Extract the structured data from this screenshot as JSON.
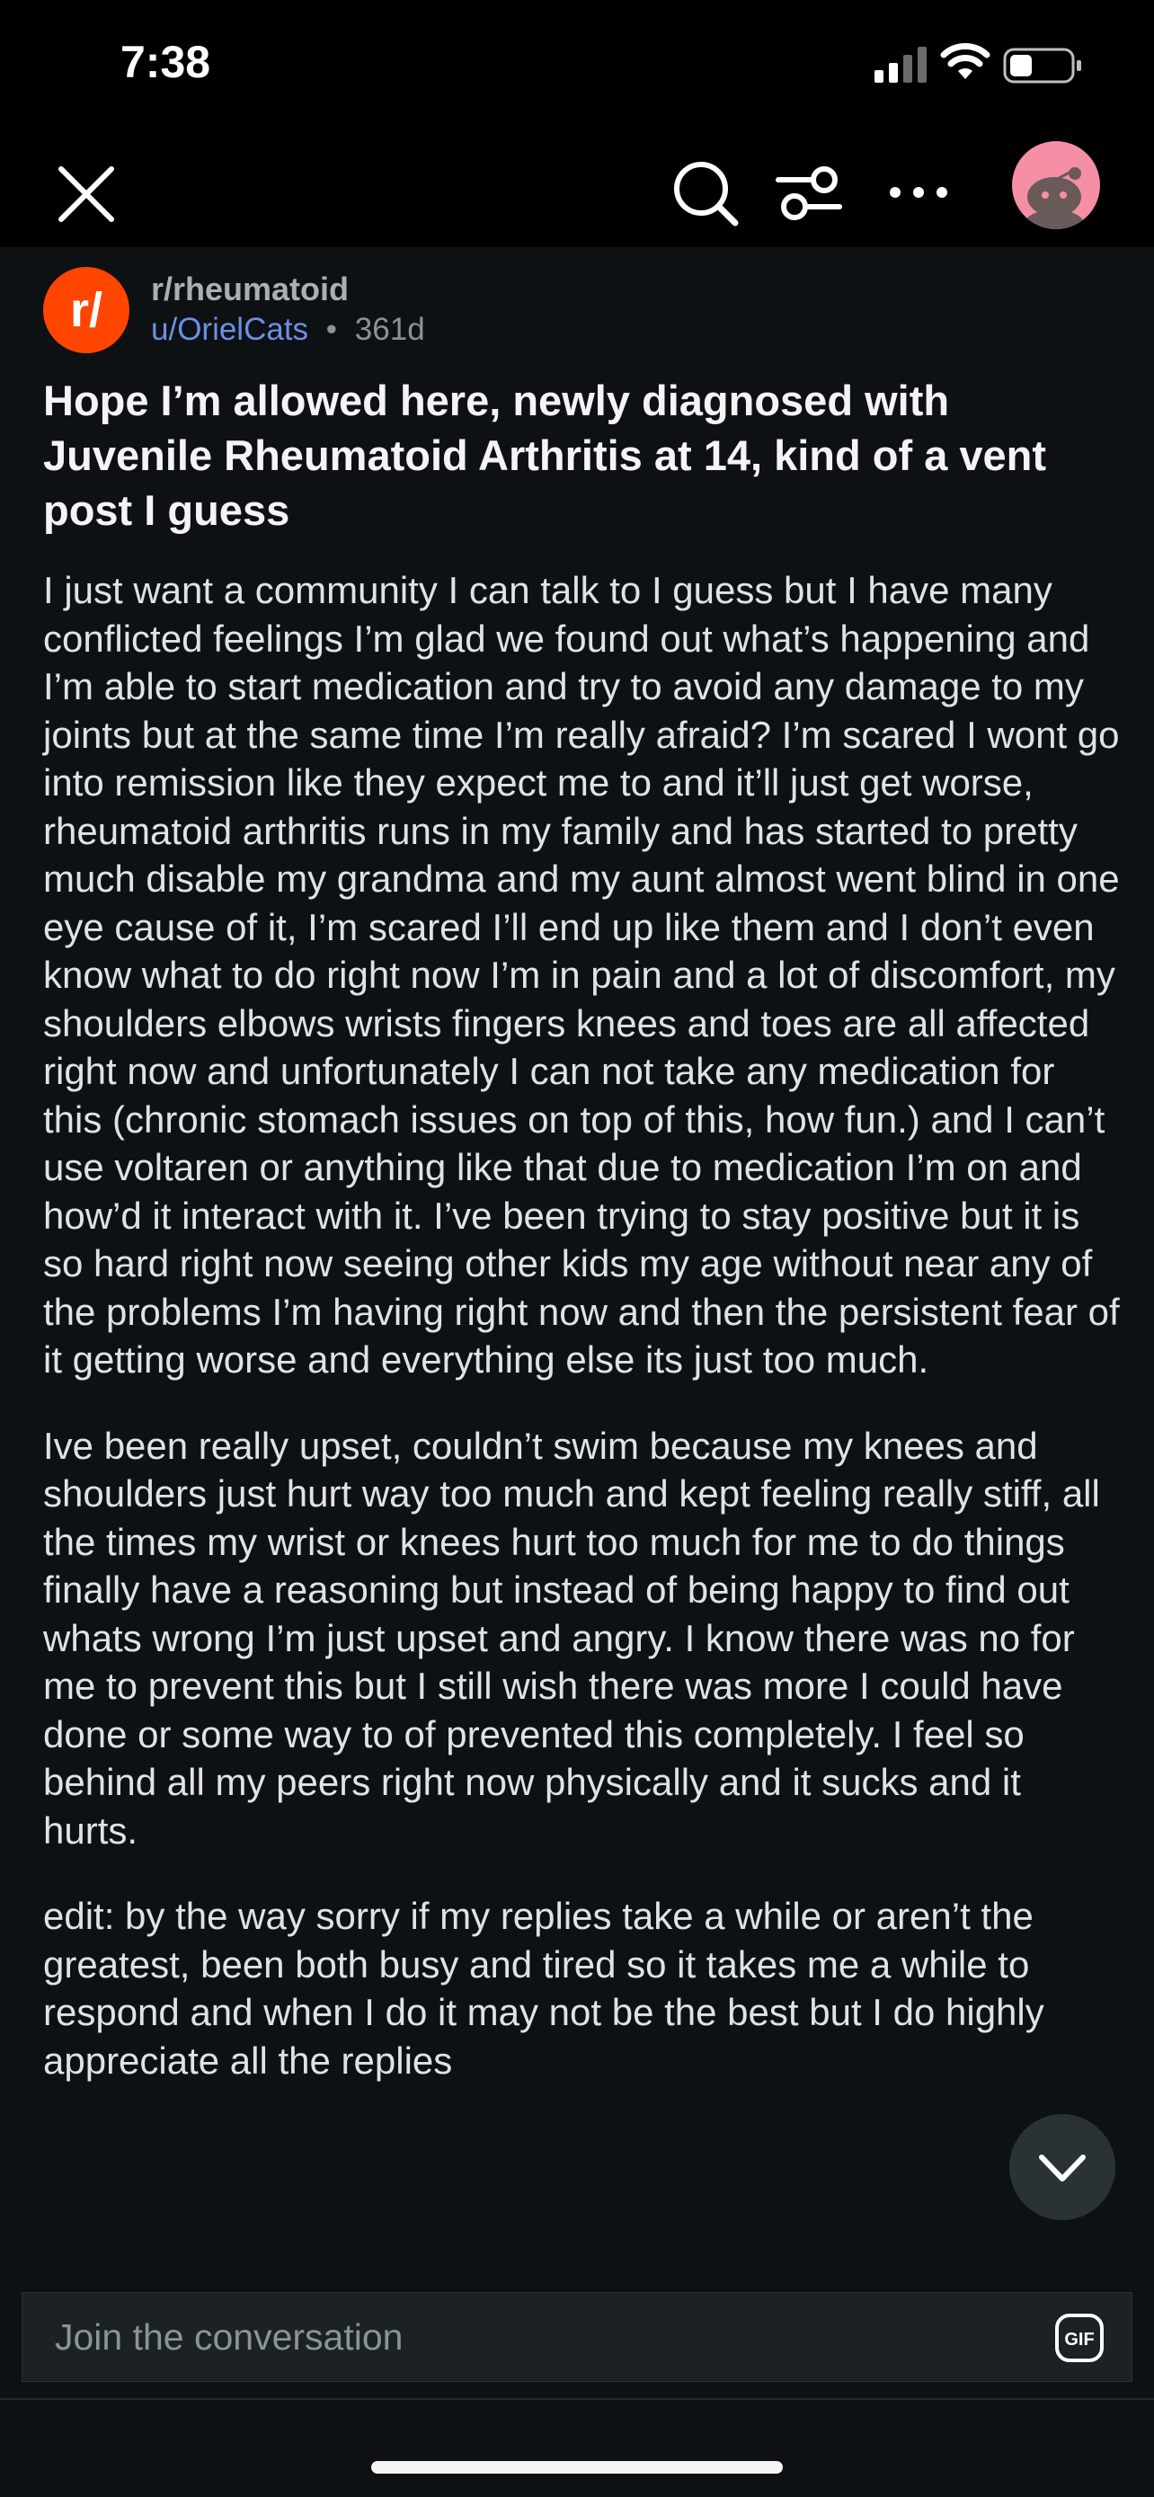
{
  "status_bar": {
    "time": "7:38"
  },
  "nav": {
    "icons": [
      "close-icon",
      "search-icon",
      "filter-icon",
      "more-icon",
      "avatar"
    ]
  },
  "post": {
    "subreddit": "r/rheumatoid",
    "author": "u/OrielCats",
    "separator": "•",
    "age": "361d",
    "title": "Hope I’m allowed here, newly diagnosed with Juvenile Rheumatoid Arthritis at 14, kind of a vent post I guess",
    "paragraphs": [
      "I just want a community I can talk to I guess but I have many conflicted feelings I’m glad we found out what’s happening and I’m able to start medication and try to avoid any damage to my joints but at the same time I’m really afraid? I’m scared I wont go into remission like they expect me to and it’ll just get worse, rheumatoid arthritis runs in my family and has started to pretty much disable my grandma and my aunt almost went blind in one eye cause of it, I’m scared I’ll end up like them and I don’t even know what to do right now I’m in pain and a lot of discomfort, my shoulders elbows wrists fingers knees and toes are all affected right now and unfortunately I can not take any medication for this (chronic stomach issues on top of this, how fun.) and I can’t use voltaren or anything like that due to medication I’m on and how’d it interact with it. I’ve been trying to stay positive but it is so hard right now seeing other kids my age without near any of the problems I’m having right now and then the persistent fear of it getting worse and everything else its just too much.",
      "Ive been really upset, couldn’t swim because my knees and shoulders just hurt way too much and kept feeling really stiff, all the times my wrist or knees hurt too much for me to do things finally have a reasoning but instead of being happy to find out whats wrong I’m just upset and angry. I know there was no for me to prevent this but I still wish there was more I could have done or some way to of prevented this completely. I feel so behind all my peers right now physically and it sucks and it hurts.",
      "edit: by the way sorry if my replies take a while or aren’t the greatest, been both busy and tired so it takes me a while to respond and when I do it may not be the best but I do highly appreciate all the replies"
    ]
  },
  "composer": {
    "placeholder": "Join the conversation"
  },
  "colors": {
    "background": "#0e1113",
    "subreddit_icon": "#ff4500",
    "author_link": "#6d8fe6",
    "avatar_bg": "#f58fa5"
  }
}
